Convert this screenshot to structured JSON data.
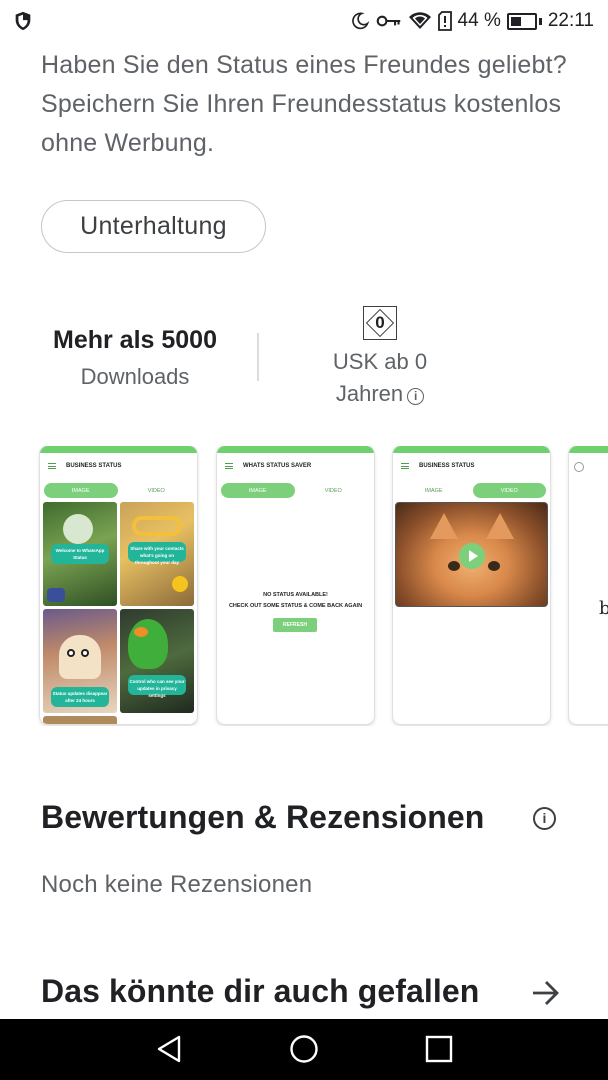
{
  "status_bar": {
    "battery_percent": "44 %",
    "time": "22:11",
    "battery_level": 0.44,
    "icons": [
      "shield-icon",
      "moon-icon",
      "key-icon",
      "wifi-icon",
      "sim-alert-icon",
      "battery-icon"
    ]
  },
  "description": "Haben Sie den Status eines Freundes geliebt? Speichern Sie Ihren Freundesstatus kostenlos ohne Werbung.",
  "category_chip": "Unterhaltung",
  "stats": {
    "downloads_value": "Mehr als 5000",
    "downloads_label": "Downloads",
    "usk_badge": "0",
    "usk_line1": "USK ab 0",
    "usk_line2": "Jahren",
    "info_symbol": "i"
  },
  "screenshots": [
    {
      "title": "BUSINESS STATUS",
      "tabs": [
        "IMAGE",
        "VIDEO"
      ],
      "active_tab": 0,
      "captions": [
        "Welcome to WhatsApp Status",
        "Share with your contacts what's going on throughout your day",
        "Status updates disappear after 24 hours",
        "Control who can see your updates in privacy settings"
      ]
    },
    {
      "title": "WHATS STATUS SAVER",
      "tabs": [
        "IMAGE",
        "VIDEO"
      ],
      "active_tab": 0,
      "empty_line1": "NO STATUS AVAILABLE!",
      "empty_line2": "CHECK OUT SOME STATUS & COME BACK AGAIN",
      "refresh_label": "REFRESH"
    },
    {
      "title": "BUSINESS STATUS",
      "tabs": [
        "IMAGE",
        "VIDEO"
      ],
      "active_tab": 1
    },
    {
      "partial_text": "bl"
    }
  ],
  "reviews": {
    "title": "Bewertungen & Rezensionen",
    "empty": "Noch keine Rezensionen"
  },
  "recommendations": {
    "title": "Das könnte dir auch gefallen"
  },
  "colors": {
    "app_green": "#7cd07c",
    "caption_teal": "#23b59a",
    "text_primary": "#202124",
    "text_secondary": "#5f6368"
  }
}
